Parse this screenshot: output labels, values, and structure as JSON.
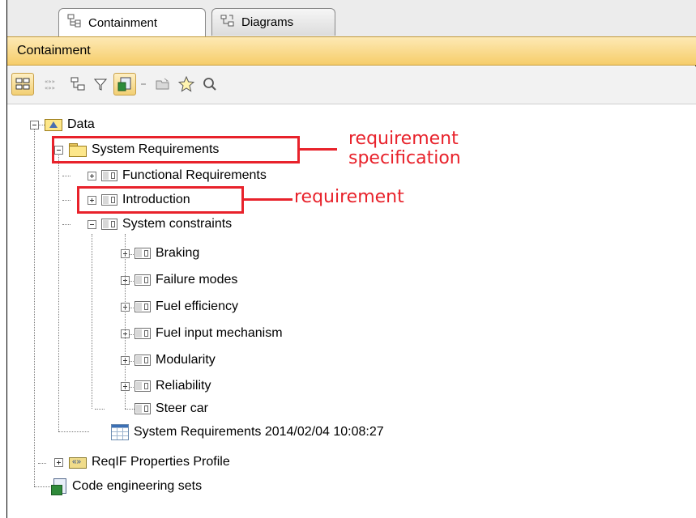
{
  "tabs": [
    {
      "label": "Containment",
      "icon": "containment-tree-icon",
      "active": true
    },
    {
      "label": "Diagrams",
      "icon": "diagrams-icon",
      "active": false
    }
  ],
  "panel": {
    "title": "Containment"
  },
  "toolbar": {
    "buttons": [
      {
        "icon": "group-by-icon",
        "pressed": true
      },
      {
        "icon": "show-auxiliary-icon",
        "pressed": false
      },
      {
        "icon": "collapse-all-icon",
        "pressed": false
      },
      {
        "icon": "filter-icon",
        "pressed": false
      },
      {
        "icon": "show-diagrams-icon",
        "pressed": true
      },
      {
        "icon": "open-folder-icon",
        "pressed": false
      },
      {
        "icon": "favorite-star-icon",
        "pressed": false
      },
      {
        "icon": "search-icon",
        "pressed": false
      }
    ]
  },
  "tree": {
    "root": "Data",
    "system_requirements": "System Requirements",
    "functional_requirements": "Functional Requirements",
    "introduction": "Introduction",
    "system_constraints": "System constraints",
    "constraints": [
      "Braking",
      "Failure modes",
      "Fuel efficiency",
      "Fuel input mechanism",
      "Modularity",
      "Reliability",
      "Steer car"
    ],
    "table": "System Requirements 2014/02/04 10:08:27",
    "profile": "ReqIF Properties Profile",
    "code_sets": "Code engineering sets"
  },
  "annotations": {
    "spec_line1": "requirement",
    "spec_line2": "specification",
    "requirement": "requirement",
    "color": "#e8222b"
  }
}
